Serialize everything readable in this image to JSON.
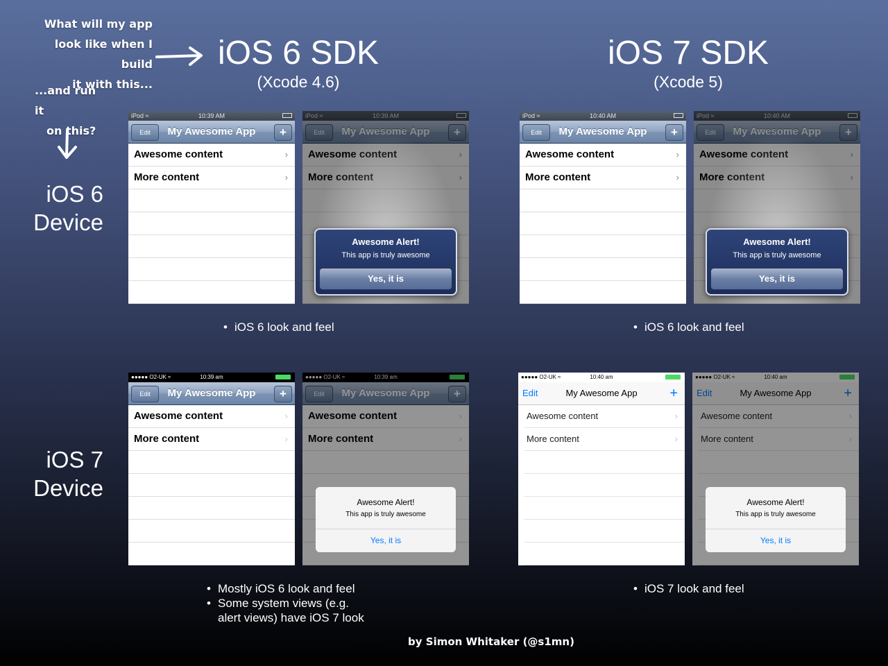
{
  "annotation": {
    "question_lines": [
      "What will my app",
      "look like when I build",
      "it with this..."
    ],
    "device_lines": [
      "...and run it",
      "on this?"
    ]
  },
  "sdks": [
    {
      "title": "iOS 6 SDK",
      "subtitle": "(Xcode 4.6)"
    },
    {
      "title": "iOS 7 SDK",
      "subtitle": "(Xcode 5)"
    }
  ],
  "devices": [
    {
      "line1": "iOS 6",
      "line2": "Device"
    },
    {
      "line1": "iOS 7",
      "line2": "Device"
    }
  ],
  "app": {
    "title": "My Awesome App",
    "edit_label": "Edit",
    "add_symbol": "+",
    "rows": [
      "Awesome content",
      "More content"
    ],
    "chevron": "›",
    "alert": {
      "title": "Awesome Alert!",
      "message": "This app is truly awesome",
      "button": "Yes, it is"
    }
  },
  "status_bars": {
    "ios6_device_sdk6": {
      "left": "iPod ≈",
      "time": "10:39 AM"
    },
    "ios6_device_sdk7": {
      "left": "iPod ≈",
      "time": "10:40 AM"
    },
    "ios7_device_sdk6": {
      "left": "●●●●● O2-UK ≈",
      "time": "10:39 am"
    },
    "ios7_device_sdk7": {
      "left": "●●●●● O2-UK ≈",
      "time": "10:40 am"
    }
  },
  "notes": {
    "ios6_sdk6": [
      "iOS 6 look and feel"
    ],
    "ios6_sdk7": [
      "iOS 6 look and feel"
    ],
    "ios7_sdk6": [
      "Mostly iOS 6 look and feel",
      "Some system views (e.g. alert views) have iOS 7 look"
    ],
    "ios7_sdk7": [
      "iOS 7 look and feel"
    ]
  },
  "credit": "by Simon Whitaker (@s1mn)"
}
